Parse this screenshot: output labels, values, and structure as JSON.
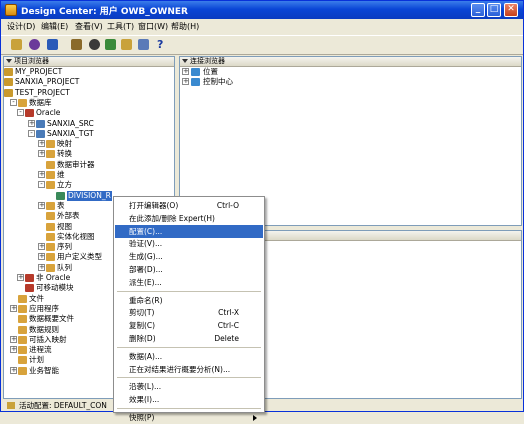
{
  "window": {
    "title": "Design Center: 用户 OWB_OWNER",
    "controls": {
      "minimize": "_",
      "maximize": "□",
      "close": "✕"
    }
  },
  "menubar": [
    "设计(D)",
    "编辑(E)",
    "查看(V)",
    "工具(T)",
    "窗口(W)",
    "帮助(H)"
  ],
  "toolbar": {
    "icons": [
      "open-icon",
      "wizard-icon",
      "key-icon",
      "tag-icon",
      "user-icon",
      "deploy-icon",
      "validate-icon",
      "arrow-icon",
      "help-icon"
    ],
    "help_glyph": "?"
  },
  "project_explorer": {
    "title": "项目浏览器",
    "tree": [
      {
        "label": "MY_PROJECT",
        "depth": 0,
        "expander": "",
        "icon_color": "#c99a2e"
      },
      {
        "label": "SANXIA_PROJECT",
        "depth": 0,
        "expander": "",
        "icon_color": "#c99a2e"
      },
      {
        "label": "TEST_PROJECT",
        "depth": 0,
        "expander": "",
        "icon_color": "#c99a2e"
      },
      {
        "label": "数据库",
        "depth": 1,
        "expander": "-",
        "icon_color": "#d8a33c"
      },
      {
        "label": "Oracle",
        "depth": 2,
        "expander": "-",
        "icon_color": "#b63a2a"
      },
      {
        "label": "SANXIA_SRC",
        "depth": 3,
        "expander": "+",
        "icon_color": "#4a7bb8"
      },
      {
        "label": "SANXIA_TGT",
        "depth": 3,
        "expander": "-",
        "icon_color": "#4a7bb8"
      },
      {
        "label": "映射",
        "depth": 4,
        "expander": "+",
        "icon_color": "#d8a33c"
      },
      {
        "label": "转换",
        "depth": 4,
        "expander": "+",
        "icon_color": "#d8a33c"
      },
      {
        "label": "数据审计器",
        "depth": 4,
        "expander": "",
        "icon_color": "#d8a33c"
      },
      {
        "label": "维",
        "depth": 4,
        "expander": "+",
        "icon_color": "#d8a33c"
      },
      {
        "label": "立方",
        "depth": 4,
        "expander": "-",
        "icon_color": "#d8a33c"
      },
      {
        "label": "DIVISION_R",
        "depth": 5,
        "expander": "",
        "icon_color": "#3a8a5a",
        "selected": true
      },
      {
        "label": "表",
        "depth": 4,
        "expander": "+",
        "icon_color": "#d8a33c"
      },
      {
        "label": "外部表",
        "depth": 4,
        "expander": "",
        "icon_color": "#d8a33c"
      },
      {
        "label": "视图",
        "depth": 4,
        "expander": "",
        "icon_color": "#d8a33c"
      },
      {
        "label": "实体化视图",
        "depth": 4,
        "expander": "",
        "icon_color": "#d8a33c"
      },
      {
        "label": "序列",
        "depth": 4,
        "expander": "+",
        "icon_color": "#d8a33c"
      },
      {
        "label": "用户定义类型",
        "depth": 4,
        "expander": "+",
        "icon_color": "#d8a33c"
      },
      {
        "label": "队列",
        "depth": 4,
        "expander": "+",
        "icon_color": "#d8a33c"
      },
      {
        "label": "非 Oracle",
        "depth": 2,
        "expander": "+",
        "icon_color": "#b63a2a"
      },
      {
        "label": "可移动模块",
        "depth": 2,
        "expander": "",
        "icon_color": "#b63a2a"
      },
      {
        "label": "文件",
        "depth": 1,
        "expander": "",
        "icon_color": "#d8a33c"
      },
      {
        "label": "应用程序",
        "depth": 1,
        "expander": "+",
        "icon_color": "#d8a33c"
      },
      {
        "label": "数据概要文件",
        "depth": 1,
        "expander": "",
        "icon_color": "#d8a33c"
      },
      {
        "label": "数据规则",
        "depth": 1,
        "expander": "",
        "icon_color": "#d8a33c"
      },
      {
        "label": "可插入映射",
        "depth": 1,
        "expander": "+",
        "icon_color": "#d8a33c"
      },
      {
        "label": "进程流",
        "depth": 1,
        "expander": "+",
        "icon_color": "#d8a33c"
      },
      {
        "label": "计划",
        "depth": 1,
        "expander": "",
        "icon_color": "#d8a33c"
      },
      {
        "label": "业务智能",
        "depth": 1,
        "expander": "+",
        "icon_color": "#d8a33c"
      }
    ]
  },
  "connection_explorer": {
    "title": "连接浏览器",
    "tree": [
      {
        "label": "位置",
        "expander": "+",
        "icon_color": "#3a8ad0"
      },
      {
        "label": "控制中心",
        "expander": "+",
        "icon_color": "#3a8ad0"
      }
    ]
  },
  "context_menu": {
    "items": [
      {
        "label": "打开编辑器(O)",
        "shortcut": "Ctrl-O"
      },
      {
        "label": "在此添加/删除 Expert(H)",
        "shortcut": ""
      },
      {
        "label": "配置(C)...",
        "shortcut": "",
        "highlighted": true
      },
      {
        "label": "验证(V)...",
        "shortcut": ""
      },
      {
        "label": "生成(G)...",
        "shortcut": ""
      },
      {
        "label": "部署(D)...",
        "shortcut": ""
      },
      {
        "label": "派生(E)...",
        "shortcut": ""
      },
      {
        "separator": true
      },
      {
        "label": "重命名(R)",
        "shortcut": ""
      },
      {
        "label": "剪切(T)",
        "shortcut": "Ctrl-X"
      },
      {
        "label": "复制(C)",
        "shortcut": "Ctrl-C"
      },
      {
        "label": "删除(D)",
        "shortcut": "Delete"
      },
      {
        "separator": true
      },
      {
        "label": "数据(A)...",
        "shortcut": ""
      },
      {
        "label": "正在对结果进行概要分析(N)...",
        "shortcut": ""
      },
      {
        "separator": true
      },
      {
        "label": "沿袭(L)...",
        "shortcut": ""
      },
      {
        "label": "效果(I)...",
        "shortcut": ""
      },
      {
        "separator": true
      },
      {
        "label": "快照(P)",
        "shortcut": "",
        "submenu": true
      }
    ]
  },
  "statusbar": {
    "text": "活动配置: DEFAULT_CON"
  },
  "colors": {
    "accent": "#316ac5",
    "titlebar": "#0a46d6",
    "chrome": "#ece9d8"
  }
}
